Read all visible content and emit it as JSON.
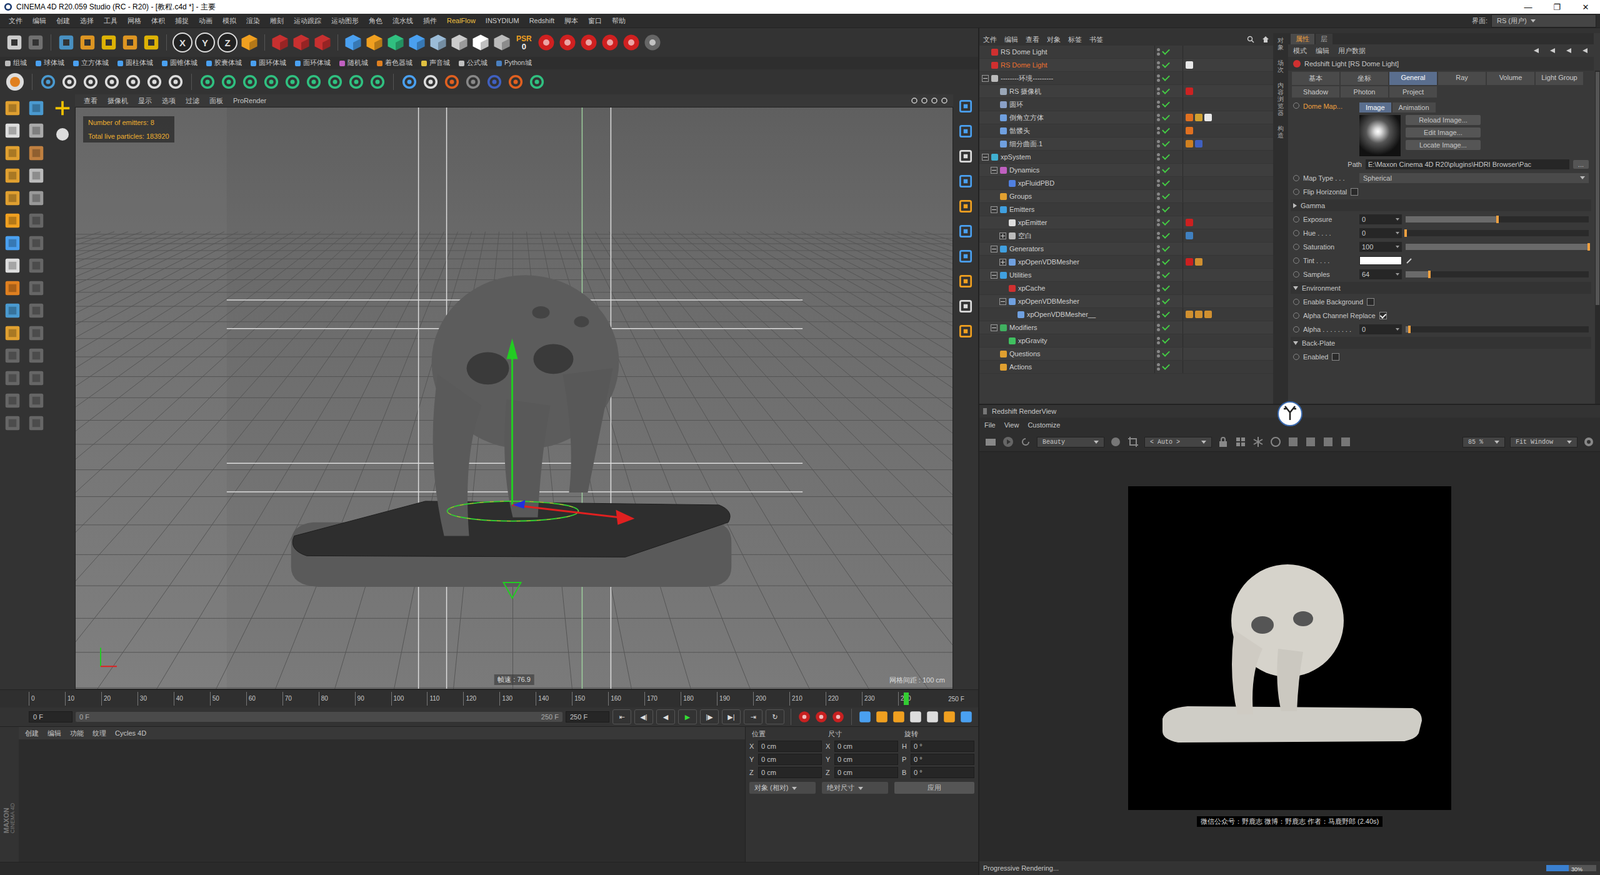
{
  "window": {
    "title": "CINEMA 4D R20.059 Studio (RC - R20) - [教程.c4d *] - 主要",
    "controls": [
      "—",
      "❐",
      "✕"
    ]
  },
  "menu": [
    "文件",
    "编辑",
    "创建",
    "选择",
    "工具",
    "网格",
    "体积",
    "捕捉",
    "动画",
    "模拟",
    "渲染",
    "雕刻",
    "运动跟踪",
    "运动图形",
    "角色",
    "流水线",
    "插件",
    "RealFlow",
    "INSYDIUM",
    "Redshift",
    "脚本",
    "窗口",
    "帮助"
  ],
  "interface": {
    "label": "界面:",
    "value": "RS (用户)"
  },
  "toolbar": {
    "axes": [
      "X",
      "Y",
      "Z"
    ],
    "psr": "PSR",
    "psr_value": "0"
  },
  "plugin_bar": [
    "组城",
    "球体城",
    "立方体城",
    "圆柱体城",
    "圆锥体城",
    "胶囊体城",
    "圆环体城",
    "面环体城",
    "随机城",
    "着色器城",
    "声音城",
    "公式城",
    "Python城"
  ],
  "viewport": {
    "menu": [
      "查看",
      "摄像机",
      "显示",
      "选项",
      "过滤",
      "面板",
      "ProRender"
    ],
    "hud": [
      "Number of emitters: 8",
      "Total live particles: 183920"
    ],
    "fps": "帧速 : 76.9",
    "grid": "网格间距 : 100 cm"
  },
  "timeline": {
    "ticks": [
      "0",
      "10",
      "20",
      "30",
      "40",
      "50",
      "60",
      "70",
      "80",
      "90",
      "100",
      "110",
      "120",
      "130",
      "140",
      "150",
      "160",
      "170",
      "180",
      "190",
      "200",
      "210",
      "220",
      "230",
      "240"
    ],
    "end": "250 F",
    "playhead": 0.975
  },
  "playback": {
    "current": "0 F",
    "range_start": "0 F",
    "range_end": "250 F",
    "end": "250 F",
    "buttons": [
      {
        "glyph": "⇤",
        "play": false
      },
      {
        "glyph": "◀|",
        "play": false
      },
      {
        "glyph": "◀",
        "play": false
      },
      {
        "glyph": "▶",
        "play": true
      },
      {
        "glyph": "|▶",
        "play": false
      },
      {
        "glyph": "▶|",
        "play": false
      },
      {
        "glyph": "⇥",
        "play": false
      },
      {
        "glyph": "↻",
        "play": false
      }
    ]
  },
  "material_manager": {
    "menu": [
      "创建",
      "编辑",
      "功能",
      "纹理",
      "Cycles 4D"
    ]
  },
  "logo": {
    "brand": "MAXON",
    "product": "CINEMA 4D"
  },
  "coordinates": {
    "columns": [
      {
        "header": "位置",
        "fields": [
          {
            "axis": "X",
            "value": "0 cm"
          },
          {
            "axis": "Y",
            "value": "0 cm"
          },
          {
            "axis": "Z",
            "value": "0 cm"
          }
        ]
      },
      {
        "header": "尺寸",
        "fields": [
          {
            "axis": "X",
            "value": "0 cm"
          },
          {
            "axis": "Y",
            "value": "0 cm"
          },
          {
            "axis": "Z",
            "value": "0 cm"
          }
        ]
      },
      {
        "header": "旋转",
        "fields": [
          {
            "axis": "H",
            "value": "0 °"
          },
          {
            "axis": "P",
            "value": "0 °"
          },
          {
            "axis": "B",
            "value": "0 °"
          }
        ]
      }
    ],
    "mode": "对象 (相对)",
    "size_mode": "绝对尺寸",
    "apply": "应用"
  },
  "object_manager": {
    "menu": [
      "文件",
      "编辑",
      "查看",
      "对象",
      "标签",
      "书签"
    ],
    "items": [
      {
        "name": "RS Dome Light",
        "depth": 0,
        "has_children": false,
        "expanded": false,
        "selected": false,
        "enabled": true,
        "icon": "#d03030",
        "tags": []
      },
      {
        "name": "RS Dome Light",
        "depth": 0,
        "has_children": false,
        "expanded": false,
        "selected": true,
        "enabled": true,
        "icon": "#d03030",
        "tags": [
          "#e8e8e8"
        ]
      },
      {
        "name": "--------环境---------",
        "depth": 0,
        "has_children": true,
        "expanded": true,
        "selected": false,
        "enabled": true,
        "icon": "#bbbbbb",
        "tags": []
      },
      {
        "name": "RS 摄像机",
        "depth": 1,
        "has_children": false,
        "expanded": false,
        "selected": false,
        "enabled": true,
        "icon": "#9aa7b8",
        "tags": [
          "#cc2222"
        ]
      },
      {
        "name": "圆环",
        "depth": 1,
        "has_children": false,
        "expanded": false,
        "selected": false,
        "enabled": true,
        "icon": "#8aa0c8",
        "tags": []
      },
      {
        "name": "倒角立方体",
        "depth": 1,
        "has_children": false,
        "expanded": false,
        "selected": false,
        "enabled": true,
        "icon": "#6fa0e0",
        "tags": [
          "#e07020",
          "#d0a030",
          "#e8e8e8"
        ]
      },
      {
        "name": "骷髅头",
        "depth": 1,
        "has_children": false,
        "expanded": false,
        "selected": false,
        "enabled": true,
        "icon": "#6fa0e0",
        "tags": [
          "#e07020"
        ]
      },
      {
        "name": "细分曲面.1",
        "depth": 1,
        "has_children": false,
        "expanded": false,
        "selected": false,
        "enabled": true,
        "icon": "#6fa0e0",
        "tags": [
          "#d08020",
          "#4060c0"
        ]
      },
      {
        "name": "xpSystem",
        "depth": 0,
        "has_children": true,
        "expanded": true,
        "selected": false,
        "enabled": true,
        "icon": "#40b0d0",
        "tags": []
      },
      {
        "name": "Dynamics",
        "depth": 1,
        "has_children": true,
        "expanded": true,
        "selected": false,
        "enabled": true,
        "icon": "#c060c0",
        "tags": []
      },
      {
        "name": "xpFluidPBD",
        "depth": 2,
        "has_children": false,
        "expanded": false,
        "selected": false,
        "enabled": true,
        "icon": "#5080e0",
        "tags": []
      },
      {
        "name": "Groups",
        "depth": 1,
        "has_children": false,
        "expanded": false,
        "selected": false,
        "enabled": true,
        "icon": "#e0a030",
        "tags": []
      },
      {
        "name": "Emitters",
        "depth": 1,
        "has_children": true,
        "expanded": true,
        "selected": false,
        "enabled": true,
        "icon": "#40a0e0",
        "tags": []
      },
      {
        "name": "xpEmitter",
        "depth": 2,
        "has_children": false,
        "expanded": false,
        "selected": false,
        "enabled": true,
        "icon": "#dddddd",
        "tags": [
          "#cc2020"
        ]
      },
      {
        "name": "空白",
        "depth": 2,
        "has_children": true,
        "expanded": false,
        "selected": false,
        "enabled": true,
        "icon": "#bbbbbb",
        "tags": [
          "#4080c0"
        ]
      },
      {
        "name": "Generators",
        "depth": 1,
        "has_children": true,
        "expanded": true,
        "selected": false,
        "enabled": true,
        "icon": "#40a0e0",
        "tags": []
      },
      {
        "name": "xpOpenVDBMesher",
        "depth": 2,
        "has_children": true,
        "expanded": false,
        "selected": false,
        "enabled": true,
        "icon": "#6fa0e0",
        "tags": [
          "#cc2020",
          "#d09030"
        ]
      },
      {
        "name": "Utilities",
        "depth": 1,
        "has_children": true,
        "expanded": true,
        "selected": false,
        "enabled": true,
        "icon": "#40a0e0",
        "tags": []
      },
      {
        "name": "xpCache",
        "depth": 2,
        "has_children": false,
        "expanded": false,
        "selected": false,
        "enabled": true,
        "icon": "#d03030",
        "tags": []
      },
      {
        "name": "xpOpenVDBMesher",
        "depth": 2,
        "has_children": true,
        "expanded": true,
        "selected": false,
        "enabled": true,
        "icon": "#6fa0e0",
        "tags": []
      },
      {
        "name": "xpOpenVDBMesher__",
        "depth": 3,
        "has_children": false,
        "expanded": false,
        "selected": false,
        "enabled": true,
        "icon": "#6fa0e0",
        "tags": [
          "#d09030",
          "#d09030",
          "#d09030"
        ]
      },
      {
        "name": "Modifiers",
        "depth": 1,
        "has_children": true,
        "expanded": true,
        "selected": false,
        "enabled": true,
        "icon": "#40b060",
        "tags": []
      },
      {
        "name": "xpGravity",
        "depth": 2,
        "has_children": false,
        "expanded": false,
        "selected": false,
        "enabled": true,
        "icon": "#40c060",
        "tags": []
      },
      {
        "name": "Questions",
        "depth": 1,
        "has_children": false,
        "expanded": false,
        "selected": false,
        "enabled": true,
        "icon": "#e0a030",
        "tags": []
      },
      {
        "name": "Actions",
        "depth": 1,
        "has_children": false,
        "expanded": false,
        "selected": false,
        "enabled": true,
        "icon": "#e0a030",
        "tags": []
      }
    ]
  },
  "side_tabs": [
    "对象",
    "场次",
    "内容浏览器",
    "构造"
  ],
  "attributes": {
    "panel_tabs": [
      {
        "label": "属性",
        "selected": true
      },
      {
        "label": "层",
        "selected": false
      }
    ],
    "menu": [
      "模式",
      "编辑",
      "用户数据"
    ],
    "title": "Redshift Light [RS Dome Light]",
    "tabs": [
      {
        "label": "基本",
        "selected": false
      },
      {
        "label": "坐标",
        "selected": false
      },
      {
        "label": "General",
        "selected": true
      },
      {
        "label": "Ray",
        "selected": false
      },
      {
        "label": "Volume",
        "selected": false
      },
      {
        "label": "Light Group",
        "selected": false
      },
      {
        "label": "Shadow",
        "selected": false
      },
      {
        "label": "Photon",
        "selected": false
      },
      {
        "label": "Project",
        "selected": false
      }
    ],
    "rows": [
      {
        "kind": "dome",
        "label": "Dome Map...",
        "tabs": [
          {
            "label": "Image",
            "selected": true
          },
          {
            "label": "Animation",
            "selected": false
          }
        ],
        "buttons": [
          "Reload Image...",
          "Edit Image...",
          "Locate Image..."
        ]
      },
      {
        "kind": "path",
        "label": "Path",
        "value": "E:\\Maxon Cinema 4D R20\\plugins\\HDRI Browser\\Pac",
        "button": "..."
      },
      {
        "kind": "select",
        "label": "Map Type . . .",
        "value": "Spherical"
      },
      {
        "kind": "check",
        "label": "Flip Horizontal",
        "checked": false
      },
      {
        "kind": "section",
        "label": "Gamma",
        "expanded": false
      },
      {
        "kind": "slider",
        "label": "Exposure",
        "value": "0",
        "level": 0.5
      },
      {
        "kind": "slider",
        "label": "Hue . . . .",
        "value": "0",
        "level": 0
      },
      {
        "kind": "slider",
        "label": "Saturation",
        "value": "100",
        "level": 1
      },
      {
        "kind": "color",
        "label": "Tint . . . .",
        "color": "#ffffff"
      },
      {
        "kind": "slider",
        "label": "Samples",
        "value": "64",
        "level": 0.13
      },
      {
        "kind": "section",
        "label": "Environment",
        "expanded": true
      },
      {
        "kind": "check",
        "label": "Enable Background",
        "checked": false
      },
      {
        "kind": "check",
        "label": "Alpha Channel Replace",
        "checked": true
      },
      {
        "kind": "slider",
        "label": "Alpha . . . . . . . .",
        "value": "0",
        "level": 0.02
      },
      {
        "kind": "section",
        "label": "Back-Plate",
        "expanded": true
      },
      {
        "kind": "check",
        "label": "Enabled",
        "checked": false
      }
    ]
  },
  "render_view": {
    "title": "Redshift RenderView",
    "menu": [
      "File",
      "View",
      "Customize"
    ],
    "aov": "Beauty",
    "auto": "< Auto >",
    "zoom": "85 %",
    "fit": "Fit Window",
    "caption": "微信公众号：野鹿志  微博：野鹿志  作者：马鹿野郎  (2.40s)",
    "status": "Progressive Rendering...",
    "progress": {
      "level": 0.45,
      "reading": "30%"
    }
  }
}
